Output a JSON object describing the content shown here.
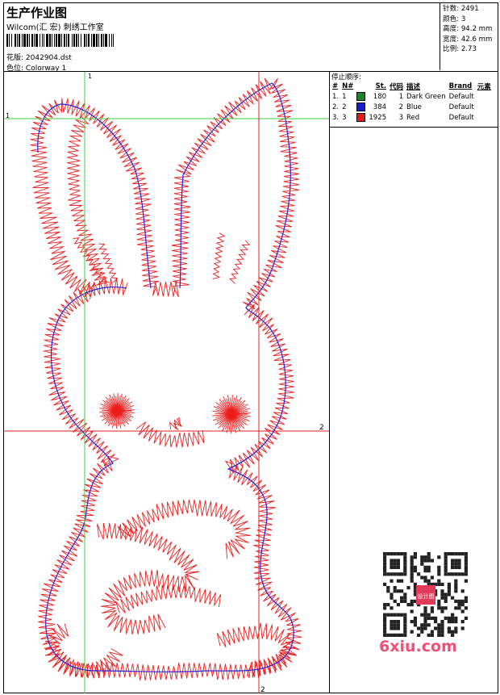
{
  "header": {
    "title": "生产作业图",
    "company": "Wilcom(汇 宏) 刺绣工作室",
    "design_label": "花版:",
    "design_value": "2042904.dst",
    "colorway_label": "色位:",
    "colorway_value": "Colorway 1"
  },
  "stats": {
    "stitches": "针数: 2491",
    "colors": "颜色: 3",
    "height": "高度: 94.2 mm",
    "width": "宽度: 42.6 mm",
    "ratio": "比例: 2.73"
  },
  "stop_sequence": {
    "title": "停止顺序:",
    "headers": [
      "#",
      "N#",
      "St.",
      "代码",
      "描述",
      "Brand",
      "元素"
    ],
    "rows": [
      {
        "idx": "1.",
        "n": "1",
        "color": "#138a1f",
        "st": "180",
        "code": "1",
        "desc": "Dark Green",
        "brand": "Default"
      },
      {
        "idx": "2.",
        "n": "2",
        "color": "#1a1ad6",
        "st": "384",
        "code": "2",
        "desc": "Blue",
        "brand": "Default"
      },
      {
        "idx": "3.",
        "n": "3",
        "color": "#e21b1b",
        "st": "1925",
        "code": "3",
        "desc": "Red",
        "brand": "Default"
      }
    ]
  },
  "guides": {
    "v1_label": "1",
    "h1_label": "1",
    "h2_label": "2",
    "v2_label": "2"
  },
  "watermark": {
    "text": "6xiu.com",
    "qr_badge": "设计图"
  },
  "colors": {
    "stitch_red": "#ee1c1c",
    "stitch_blue": "#2222dd",
    "guide_green": "#3ecf3e",
    "guide_red": "#e02020"
  }
}
